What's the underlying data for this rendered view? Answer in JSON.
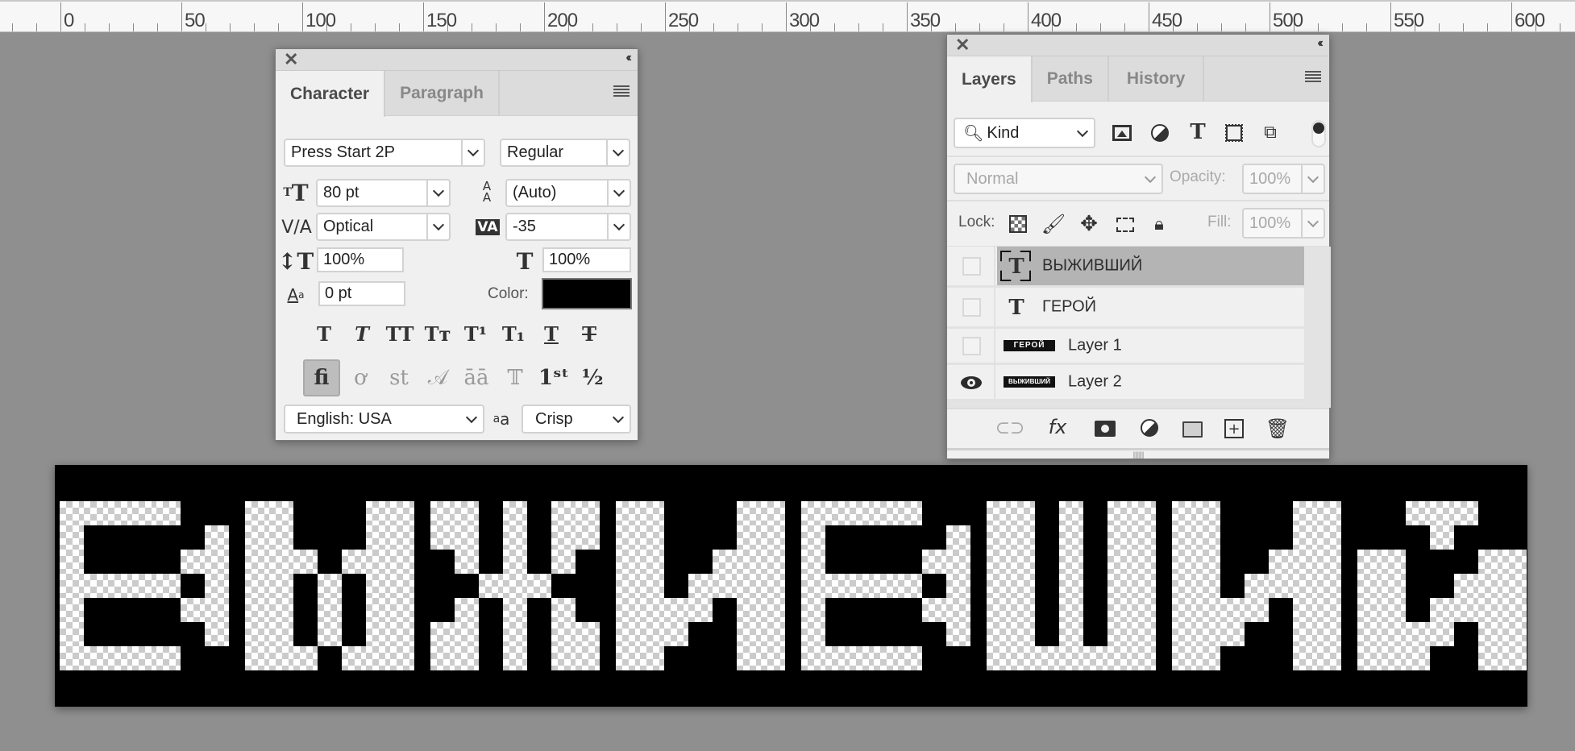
{
  "ruler": {
    "labels": [
      "0",
      "50",
      "100",
      "150",
      "200",
      "250",
      "300",
      "350",
      "400",
      "450",
      "500",
      "550",
      "600"
    ]
  },
  "character_panel": {
    "tabs": [
      {
        "label": "Character",
        "active": true
      },
      {
        "label": "Paragraph",
        "active": false
      }
    ],
    "font_family": "Press Start 2P",
    "font_style": "Regular",
    "font_size": "80 pt",
    "leading": "(Auto)",
    "kerning": "Optical",
    "tracking": "-35",
    "vertical_scale": "100%",
    "horizontal_scale": "100%",
    "baseline_shift": "0 pt",
    "color_label": "Color:",
    "color_value": "#000000",
    "type_style_buttons": [
      "Faux Bold",
      "Faux Italic",
      "All Caps",
      "Small Caps",
      "Superscript",
      "Subscript",
      "Underline",
      "Strikethrough"
    ],
    "opentype_buttons": [
      "Standard Ligatures",
      "Contextual Alternates",
      "Discretionary Ligatures",
      "Swash",
      "Stylistic Alternates",
      "Titling Alternates",
      "Ordinals",
      "Fractions"
    ],
    "opentype_active": "Standard Ligatures",
    "language": "English: USA",
    "antialias": "Crisp"
  },
  "layers_panel": {
    "tabs": [
      {
        "label": "Layers",
        "active": true
      },
      {
        "label": "Paths",
        "active": false
      },
      {
        "label": "History",
        "active": false
      }
    ],
    "filter_kind": "Kind",
    "blend_mode": "Normal",
    "opacity_label": "Opacity:",
    "opacity": "100%",
    "lock_label": "Lock:",
    "fill_label": "Fill:",
    "fill": "100%",
    "layers": [
      {
        "name": "ВЫЖИВШИЙ",
        "type": "text",
        "visible": false,
        "selected": true
      },
      {
        "name": "ГЕРОЙ",
        "type": "text",
        "visible": false,
        "selected": false
      },
      {
        "name": "Layer 1",
        "type": "pixel",
        "visible": false,
        "selected": false,
        "thumb": "ГЕРОЙ"
      },
      {
        "name": "Layer 2",
        "type": "pixel",
        "visible": true,
        "selected": false,
        "thumb": "ВЫЖИВШИЙ"
      }
    ]
  },
  "canvas": {
    "text": "ВЫЖИВШИЙ",
    "background": "#000000"
  }
}
